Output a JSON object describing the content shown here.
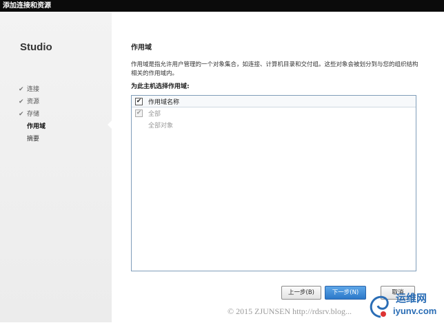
{
  "window": {
    "title": "添加连接和资源"
  },
  "sidebar": {
    "brand": "Studio",
    "steps": [
      {
        "label": "连接",
        "state": "done"
      },
      {
        "label": "资源",
        "state": "done"
      },
      {
        "label": "存储",
        "state": "done"
      },
      {
        "label": "作用域",
        "state": "current"
      },
      {
        "label": "摘要",
        "state": "pending"
      }
    ],
    "check_glyph": "✔"
  },
  "main": {
    "heading": "作用域",
    "description": "作用域是指允许用户管理的一个对象集合，如连接、计算机目录和交付组。这些对象会被划分到与您的组织结构相关的作用域内。",
    "prompt": "为此主机选择作用域:",
    "list": {
      "header_label": "作用域名称",
      "header_checked": true,
      "rows": [
        {
          "label": "全部",
          "checked": true,
          "disabled": true
        },
        {
          "label": "全部对象",
          "indent": true
        }
      ]
    }
  },
  "buttons": {
    "back": "上一步(B)",
    "next": "下一步(N)",
    "cancel": "取消"
  },
  "watermark": {
    "text": "© 2015 ZJUNSEN http://rdsrv.blog..."
  },
  "logo": {
    "cn": "运维网",
    "en": "iyunv.com"
  },
  "colors": {
    "accent": "#2b78c9",
    "titlebar": "#0b0b0b",
    "list_border": "#7f9db9"
  }
}
